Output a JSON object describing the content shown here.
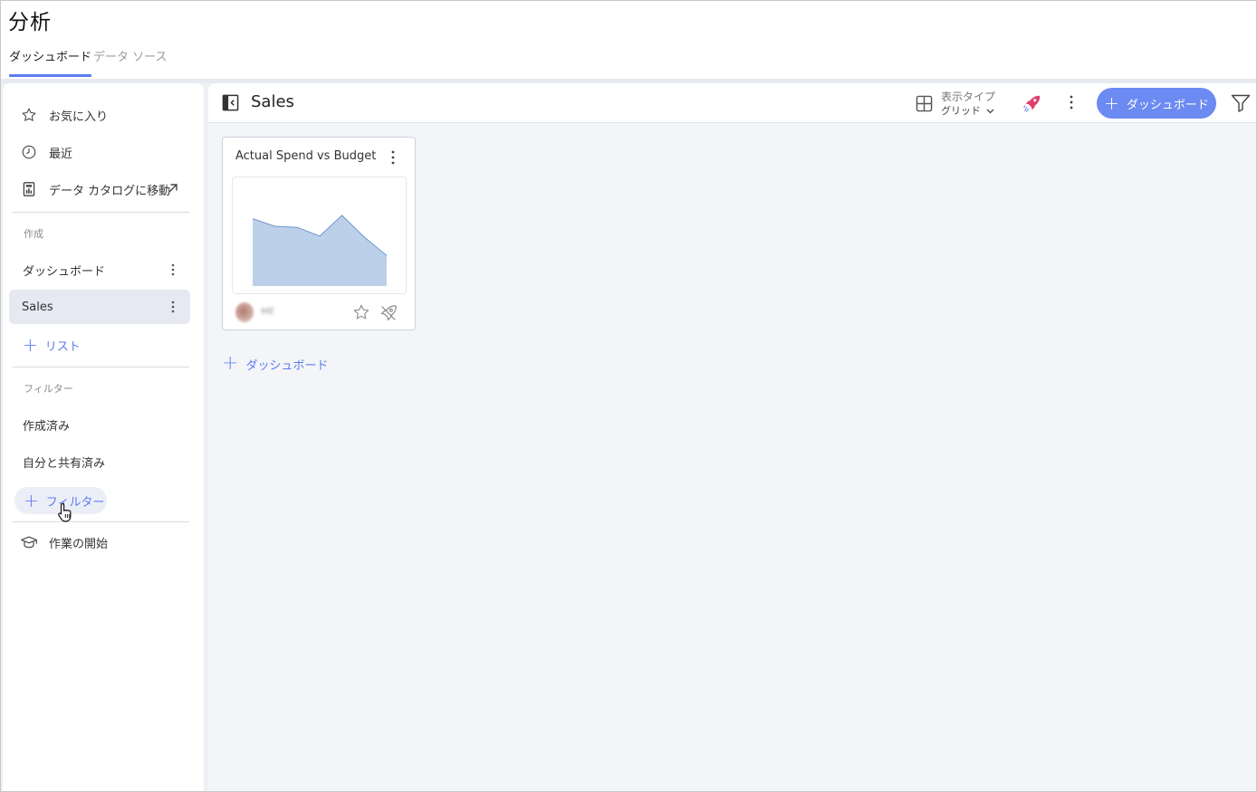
{
  "app": {
    "title": "分析"
  },
  "tabs": [
    {
      "label": "ダッシュボード",
      "active": true
    },
    {
      "label": "データ ソース",
      "active": false
    }
  ],
  "sidebar": {
    "top_items": [
      {
        "label": "お気に入り",
        "icon": "star-icon"
      },
      {
        "label": "最近",
        "icon": "clock-icon"
      },
      {
        "label": "データ カタログに移動",
        "icon": "catalog-icon",
        "trailing_icon": "external-link-icon"
      }
    ],
    "create_section": {
      "label": "作成",
      "items": [
        {
          "label": "ダッシュボード",
          "selected": false
        },
        {
          "label": "Sales",
          "selected": true
        }
      ],
      "add_label": "リスト"
    },
    "filter_section": {
      "label": "フィルター",
      "items": [
        {
          "label": "作成済み"
        },
        {
          "label": "自分と共有済み"
        }
      ],
      "add_label": "フィルター"
    },
    "getting_started": {
      "label": "作業の開始",
      "icon": "graduation-cap-icon"
    }
  },
  "main": {
    "title": "Sales",
    "display_type": {
      "label": "表示タイプ",
      "value": "グリッド"
    },
    "new_button_label": "ダッシュボード",
    "cards": [
      {
        "title": "Actual Spend vs Budget",
        "owner": "ME",
        "thumbnail": {
          "type": "area",
          "values": [
            62,
            55,
            54,
            46,
            65,
            45,
            28
          ]
        }
      }
    ],
    "add_dashboard_label": "ダッシュボード"
  },
  "colors": {
    "accent": "#5b7cf0",
    "button": "#6b8af2",
    "rocket": "#e23d6e",
    "thumbnail_fill": "#bcd0ea",
    "thumbnail_line": "#6e97cc",
    "selected_bg": "#e6e8f2",
    "main_bg": "#f4f5f9"
  }
}
